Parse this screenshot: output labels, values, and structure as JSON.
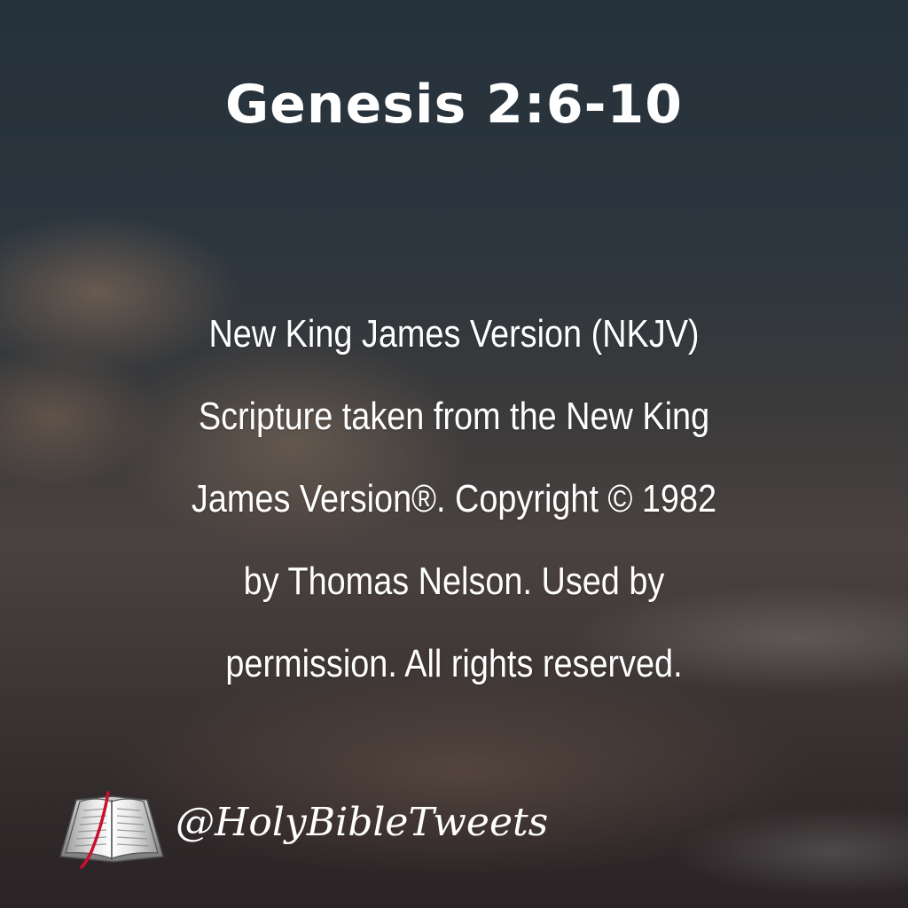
{
  "title": "Genesis 2:6-10",
  "notice": {
    "lines": [
      "New King James Version (NKJV)",
      "Scripture taken from the New King",
      "James Version®. Copyright © 1982",
      "by Thomas Nelson. Used by",
      "permission. All rights reserved."
    ]
  },
  "footer": {
    "handle": "@HolyBibleTweets",
    "icon": "open-bible-icon"
  },
  "colors": {
    "text": "#ffffff",
    "bookmark": "#c8102e"
  }
}
